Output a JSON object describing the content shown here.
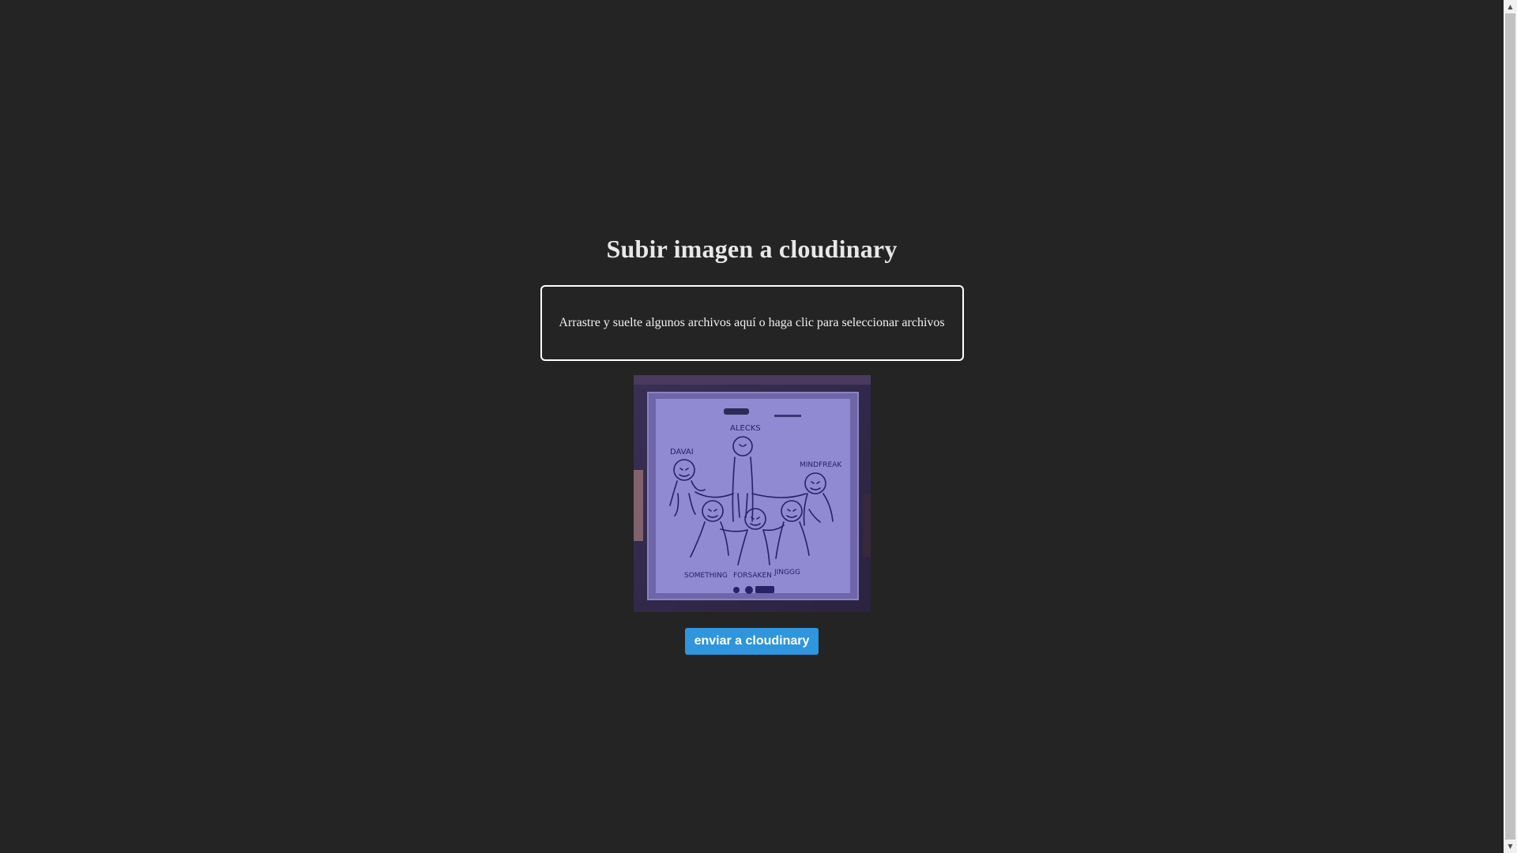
{
  "page": {
    "title": "Subir imagen a cloudinary"
  },
  "dropzone": {
    "text": "Arrastre y suelte algunos archivos aquí o haga clic para seleccionar archivos"
  },
  "preview": {
    "description_icon": "image-preview",
    "labels": [
      "ALECKS",
      "DAVAI",
      "MINDFREAK",
      "SOMETHING",
      "FORSAKEN",
      "JINGGG"
    ]
  },
  "actions": {
    "submit_label": "enviar a cloudinary"
  },
  "colors": {
    "background": "#242424",
    "accent": "#2f95dc",
    "text": "#e8e8e8",
    "border": "#ffffff"
  },
  "scrollbar": {
    "up_icon": "scroll-up-arrow-icon",
    "down_icon": "scroll-down-arrow-icon"
  }
}
